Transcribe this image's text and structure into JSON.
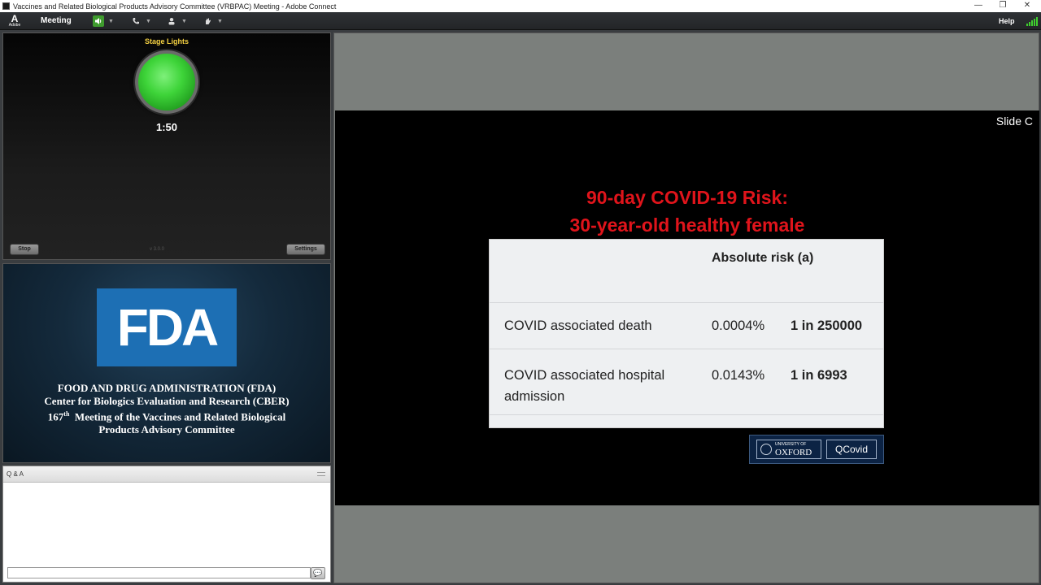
{
  "window": {
    "title": "Vaccines and Related Biological Products Advisory Committee (VRBPAC) Meeting - Adobe Connect",
    "minimize": "—",
    "restore": "❐",
    "close": "✕"
  },
  "menubar": {
    "adobe_logo": "A",
    "adobe_text": "Adobe",
    "meeting_label": "Meeting",
    "help_label": "Help",
    "icons": [
      "speaker-icon",
      "phone-icon",
      "user-icon",
      "raise-hand-icon",
      "signal-icon"
    ]
  },
  "stage_lights": {
    "title": "Stage Lights",
    "timer": "1:50",
    "stop_label": "Stop",
    "settings_label": "Settings",
    "version": "v 3.0.0"
  },
  "fda": {
    "logo_text": "FDA",
    "line1": "FOOD AND DRUG ADMINISTRATION (FDA)",
    "line2": "Center for Biologics Evaluation and Research (CBER)",
    "line3_num": "167",
    "line3_sup": "th",
    "line3_rest": "  Meeting of the Vaccines and Related Biological",
    "line4": "Products Advisory Committee"
  },
  "qa": {
    "title": "Q & A",
    "send_icon": "💬"
  },
  "slide": {
    "label": "Slide C",
    "title_line1": "90-day COVID-19 Risk:",
    "title_line2": "30-year-old healthy female",
    "table": {
      "header": "Absolute risk (a)",
      "rows": [
        {
          "label": "COVID associated death",
          "label2": "",
          "percent": "0.0004%",
          "ratio": "1 in 250000"
        },
        {
          "label": "COVID associated hospital",
          "label2": "admission",
          "percent": "0.0143%",
          "ratio": "1 in 6993"
        }
      ]
    },
    "logos": {
      "oxford_small": "UNIVERSITY OF",
      "oxford": "OXFORD",
      "qcovid": "QCovid"
    }
  },
  "colors": {
    "slide_title": "#e0141b",
    "stage_title": "#f5d142",
    "fda_blue": "#1d6fb4",
    "light_green": "#3ed439"
  }
}
